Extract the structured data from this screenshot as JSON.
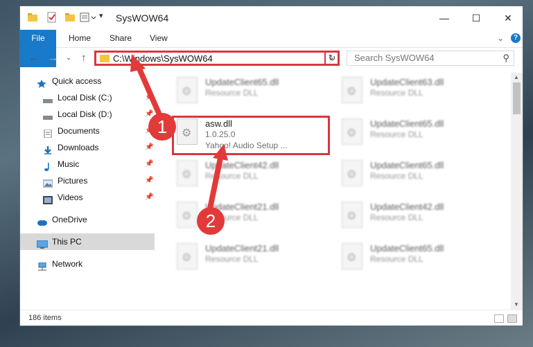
{
  "window": {
    "title": "SysWOW64",
    "minimize": "—",
    "maximize": "☐",
    "close": "✕"
  },
  "ribbon": {
    "tabs": [
      "File",
      "Home",
      "Share",
      "View"
    ],
    "expand": "⌄",
    "help": "?"
  },
  "nav": {
    "back": "←",
    "forward": "→",
    "recent": "⌄",
    "up": "↑",
    "address": "C:\\Windows\\SysWOW64",
    "address_chevron": "⌄",
    "refresh": "↻",
    "search_placeholder": "Search SysWOW64",
    "search_icon": "⚲"
  },
  "sidebar": {
    "items": [
      {
        "label": "Quick access",
        "icon": "star-icon",
        "pinned": false
      },
      {
        "label": "Local Disk (C:)",
        "icon": "drive-icon",
        "pinned": true
      },
      {
        "label": "Local Disk (D:)",
        "icon": "drive-icon",
        "pinned": true
      },
      {
        "label": "Documents",
        "icon": "documents-icon",
        "pinned": true
      },
      {
        "label": "Downloads",
        "icon": "download-icon",
        "pinned": true
      },
      {
        "label": "Music",
        "icon": "music-icon",
        "pinned": true
      },
      {
        "label": "Pictures",
        "icon": "pictures-icon",
        "pinned": true
      },
      {
        "label": "Videos",
        "icon": "videos-icon",
        "pinned": true
      },
      {
        "label": "OneDrive",
        "icon": "cloud-icon",
        "pinned": false
      },
      {
        "label": "This PC",
        "icon": "computer-icon",
        "pinned": false,
        "selected": true
      },
      {
        "label": "Network",
        "icon": "network-icon",
        "pinned": false
      }
    ]
  },
  "files": [
    {
      "name": "UpdateClient65.dll",
      "type": "Resource DLL"
    },
    {
      "name": "UpdateClient63.dll",
      "type": "Resource DLL"
    },
    {
      "name": "asw.dll",
      "version": "1.0.25.0",
      "description": "Yahoo! Audio Setup ..."
    },
    {
      "name": "UpdateClient65.dll",
      "type": "Resource DLL"
    },
    {
      "name": "UpdateClient42.dll",
      "type": "Resource DLL"
    },
    {
      "name": "UpdateClient65.dll",
      "type": "Resource DLL"
    },
    {
      "name": "UpdateClient21.dll",
      "type": "Resource DLL"
    },
    {
      "name": "UpdateClient42.dll",
      "type": "Resource DLL"
    },
    {
      "name": "UpdateClient21.dll",
      "type": "Resource DLL"
    },
    {
      "name": "UpdateClient65.dll",
      "type": "Resource DLL"
    }
  ],
  "status": {
    "count": "186 items"
  },
  "callouts": [
    "1",
    "2"
  ],
  "colors": {
    "accent": "#1979ca",
    "highlight": "#d9363e",
    "callout": "#e23a3a"
  }
}
